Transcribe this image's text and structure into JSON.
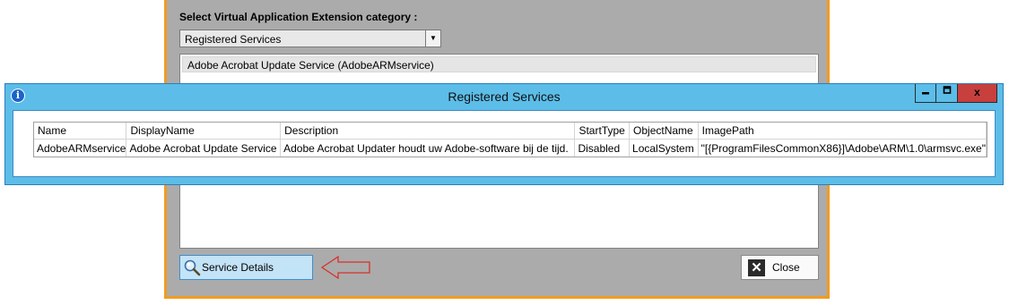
{
  "background_dialog": {
    "category_label": "Select Virtual Application Extension category :",
    "category_select": {
      "value": "Registered Services"
    },
    "services_list": [
      {
        "label": "Adobe Acrobat Update Service (AdobeARMservice)"
      }
    ],
    "service_details_button": "Service Details",
    "close_button": "Close",
    "annotation_arrow_color": "#d9302a"
  },
  "modal": {
    "title": "Registered Services",
    "info_icon_glyph": "i",
    "close_glyph": "x",
    "columns": [
      "Name",
      "DisplayName",
      "Description",
      "StartType",
      "ObjectName",
      "ImagePath"
    ],
    "rows": [
      {
        "name": "AdobeARMservice",
        "display_name": "Adobe Acrobat Update Service",
        "description": "Adobe Acrobat Updater houdt uw Adobe-software bij de tijd.",
        "start_type": "Disabled",
        "object_name": "LocalSystem",
        "image_path": "\"[{ProgramFilesCommonX86}]\\Adobe\\ARM\\1.0\\armsvc.exe\""
      }
    ]
  },
  "colors": {
    "accent_border": "#f29b1f",
    "titlebar": "#5cbde8",
    "close_button": "#c7403d"
  }
}
